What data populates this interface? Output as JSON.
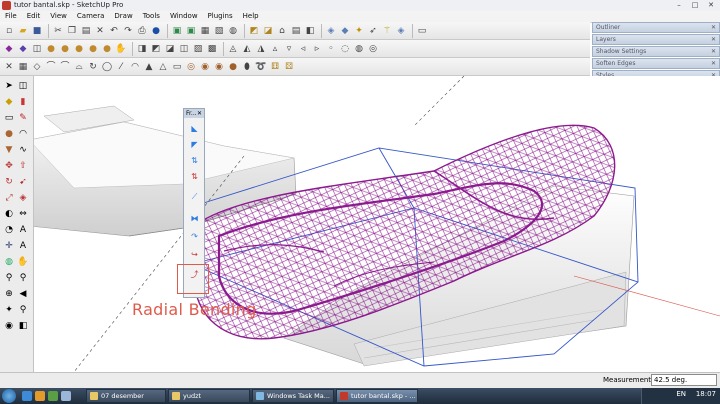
{
  "window": {
    "title": "tutor bantal.skp - SketchUp Pro"
  },
  "menu": [
    "File",
    "Edit",
    "View",
    "Camera",
    "Draw",
    "Tools",
    "Window",
    "Plugins",
    "Help"
  ],
  "trays": [
    "Outliner",
    "Layers",
    "Shadow Settings",
    "Soften Edges",
    "Styles"
  ],
  "floating_toolbar": {
    "title": "Fr..."
  },
  "annotation": "Radial Bending",
  "status": {
    "measurements_label": "Measurements",
    "measurements_value": "42.5 deg."
  },
  "taskbar": {
    "items": [
      "07 desember",
      "yudzt",
      "Windows Task Ma...",
      "tutor bantal.skp - ..."
    ],
    "language": "EN",
    "clock": "18:07"
  },
  "colors": {
    "wireframe": "#8b1a8e",
    "bbox": "#3556c8",
    "annotation": "#e05a4a"
  }
}
